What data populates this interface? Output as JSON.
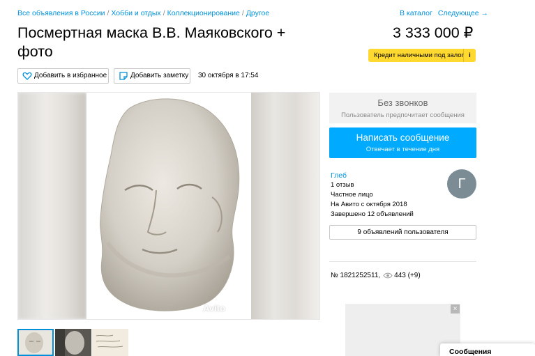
{
  "breadcrumbs": [
    "Все объявления в России",
    "Хобби и отдых",
    "Коллекционирование",
    "Другое"
  ],
  "topnav": {
    "catalog": "В каталог",
    "next": "Следующее →"
  },
  "listing": {
    "title": "Посмертная маска В.В. Маяковского + фото",
    "price": "3 333 000 ₽",
    "credit": "Кредит наличными под залог",
    "credit_info": "i",
    "add_favorite": "Добавить в избранное",
    "add_note": "Добавить заметку",
    "date": "30 октября в 17:54",
    "watermark": "Avito"
  },
  "contact": {
    "no_calls_title": "Без звонков",
    "no_calls_sub": "Пользователь предпочитает сообщения",
    "write_title": "Написать сообщение",
    "write_sub": "Отвечает в течение дня"
  },
  "seller": {
    "name": "Глеб",
    "reviews": "1 отзыв",
    "type": "Частное лицо",
    "since": "На Авито с октября 2018",
    "completed": "Завершено 12 объявлений",
    "avatar_letter": "Г",
    "user_ads": "9 объявлений пользователя"
  },
  "stats": {
    "number": "№ 1821252511,",
    "views": "443 (+9)"
  },
  "ad": {
    "close": "×"
  },
  "messages": {
    "label": "Сообщения"
  },
  "colors": {
    "link": "#0091d9",
    "primary_button": "#00aaff",
    "credit_badge": "#ffd830",
    "avatar": "#7b8c95"
  }
}
